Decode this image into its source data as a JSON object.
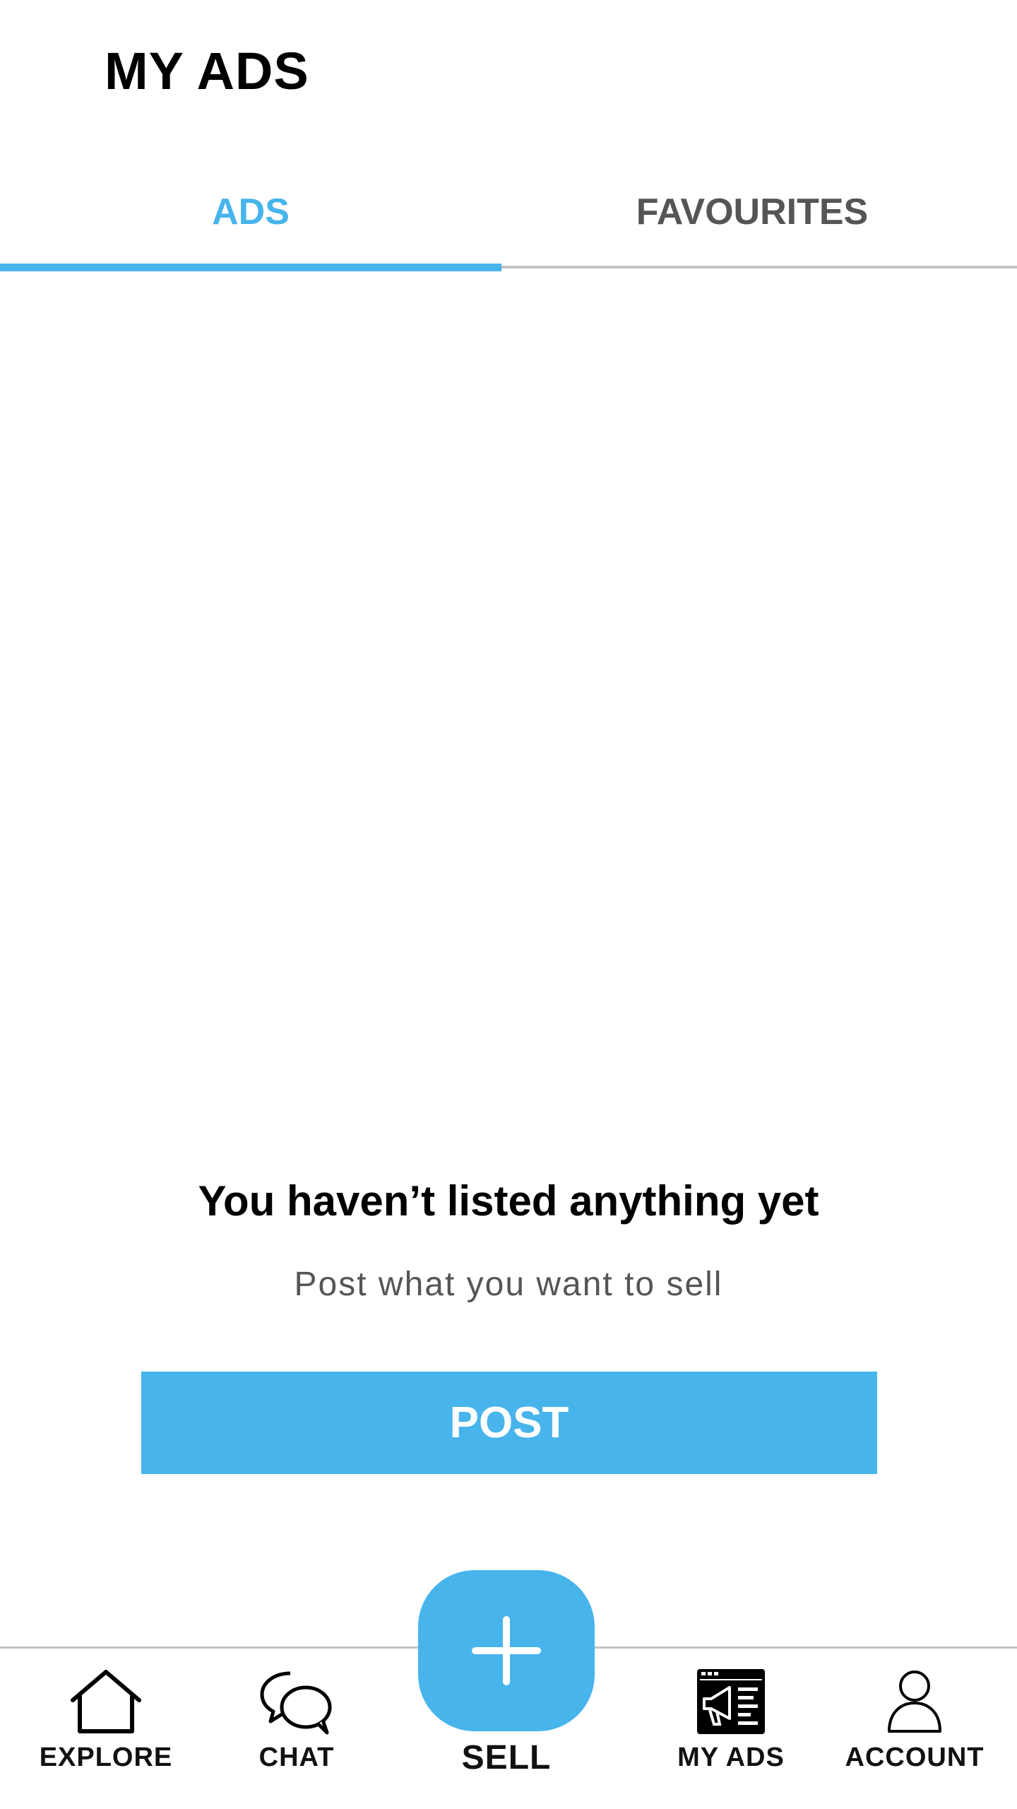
{
  "header": {
    "title": "MY ADS"
  },
  "tabs": [
    {
      "label": "ADS",
      "active": true
    },
    {
      "label": "FAVOURITES",
      "active": false
    }
  ],
  "empty_state": {
    "title": "You haven’t listed anything yet",
    "subtitle": "Post what you want to sell",
    "button_label": "POST"
  },
  "bottom_nav": {
    "items": [
      {
        "label": "EXPLORE",
        "icon": "home-icon"
      },
      {
        "label": "CHAT",
        "icon": "chat-bubbles-icon"
      },
      {
        "label": "SELL",
        "icon": "plus-icon"
      },
      {
        "label": "MY ADS",
        "icon": "megaphone-ads-icon"
      },
      {
        "label": "ACCOUNT",
        "icon": "user-icon"
      }
    ]
  },
  "colors": {
    "accent": "#47B4EC",
    "text": "#000000",
    "muted": "#555555",
    "divider": "#C4C4C4"
  }
}
